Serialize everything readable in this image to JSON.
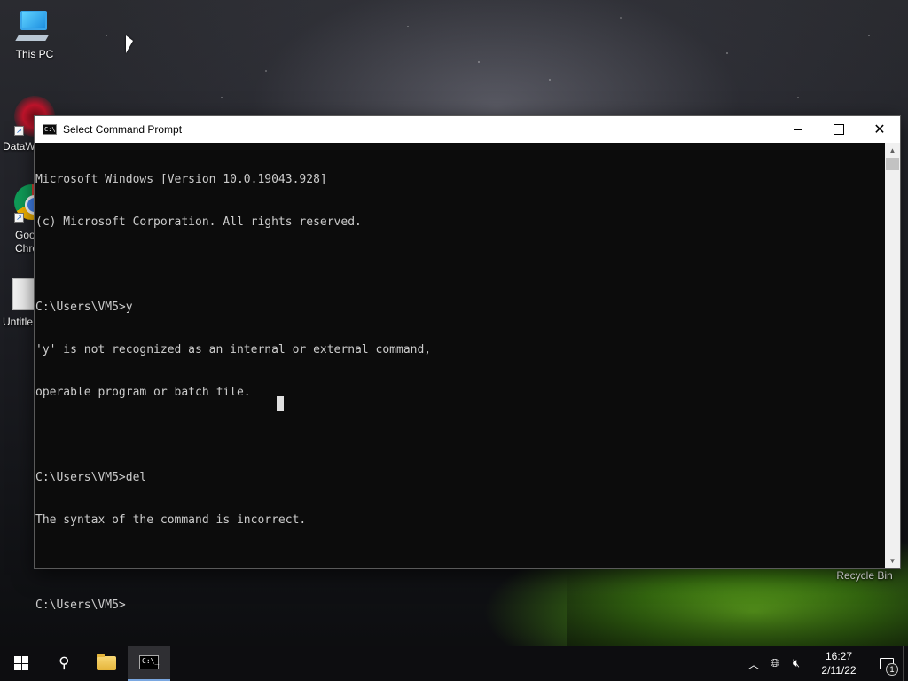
{
  "desktop": {
    "icons": [
      {
        "label": "This PC"
      },
      {
        "label": "DataW"
      },
      {
        "label": "Goo\nChro"
      },
      {
        "label": "Untitle"
      },
      {
        "label": "Recycle Bin"
      }
    ]
  },
  "window": {
    "title": "Select Command Prompt",
    "controls": {
      "minimize": "minimize",
      "maximize": "maximize",
      "close": "✕"
    }
  },
  "console": {
    "lines": [
      "Microsoft Windows [Version 10.0.19043.928]",
      "(c) Microsoft Corporation. All rights reserved.",
      "",
      "C:\\Users\\VM5>y",
      "'y' is not recognized as an internal or external command,",
      "operable program or batch file.",
      "",
      "C:\\Users\\VM5>del",
      "The syntax of the command is incorrect.",
      "",
      "C:\\Users\\VM5>"
    ]
  },
  "taskbar": {
    "items": [
      "start-icon",
      "search-icon",
      "file-explorer-icon",
      "command-prompt-icon"
    ],
    "tray": {
      "time": "16:27",
      "date": "2/11/22",
      "notification_count": "1"
    }
  }
}
